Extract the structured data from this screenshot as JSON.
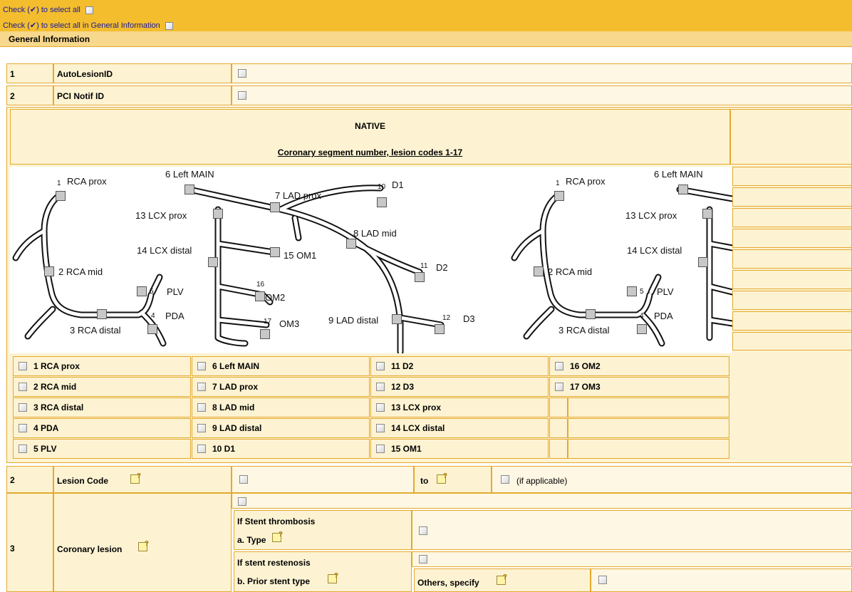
{
  "header": {
    "select_all": "Check (✔) to select all",
    "select_all_general": "Check (✔) to select all in General Information",
    "section_title": "General Information"
  },
  "rows": [
    {
      "num": "1",
      "label": "AutoLesionID"
    },
    {
      "num": "2",
      "label": "PCI Notif ID"
    }
  ],
  "native": {
    "title": "NATIVE",
    "subtitle": "Coronary segment number, lesion codes 1-17"
  },
  "diagram_labels": {
    "l1": "1",
    "rca_prox": "RCA prox",
    "left_main": "6 Left MAIN",
    "lad_prox": "7 LAD prox",
    "l10": "10",
    "d1": "D1",
    "lcx_prox": "13 LCX prox",
    "lad_mid": "8 LAD mid",
    "lcx_distal": "14 LCX distal",
    "om1": "15 OM1",
    "rca_mid": "2 RCA mid",
    "d2_num": "11",
    "d2": "D2",
    "l5": "5",
    "plv": "PLV",
    "l16": "16",
    "om2": "OM2",
    "l4": "4",
    "pda": "PDA",
    "lad_distal": "9 LAD distal",
    "l12": "12",
    "d3": "D3",
    "l17": "17",
    "om3": "OM3",
    "rca_distal": "3 RCA distal"
  },
  "segments": [
    [
      "1 RCA prox",
      "6 Left MAIN",
      "11 D2",
      "16 OM2"
    ],
    [
      "2 RCA mid",
      "7 LAD prox",
      "12 D3",
      "17 OM3"
    ],
    [
      "3 RCA distal",
      "8 LAD mid",
      "13 LCX prox",
      ""
    ],
    [
      "4 PDA",
      "9 LAD distal",
      "14 LCX distal",
      ""
    ],
    [
      "5 PLV",
      "10 D1",
      "15 OM1",
      ""
    ]
  ],
  "lesion_code": {
    "num": "2",
    "label": "Lesion Code",
    "to": "to",
    "if_applicable": "(if applicable)"
  },
  "coronary_lesion": {
    "num": "3",
    "label": "Coronary lesion",
    "stent_thrombosis": "If Stent thrombosis",
    "type_label": "a. Type",
    "stent_restenosis": "If stent restenosis",
    "prior_stent": "b. Prior stent type",
    "others": "Others, specify"
  },
  "colors": {
    "bar": "#f3bd2e",
    "cell": "#fdf3d2",
    "border": "#e4a92e",
    "link": "#1a1a9a"
  }
}
